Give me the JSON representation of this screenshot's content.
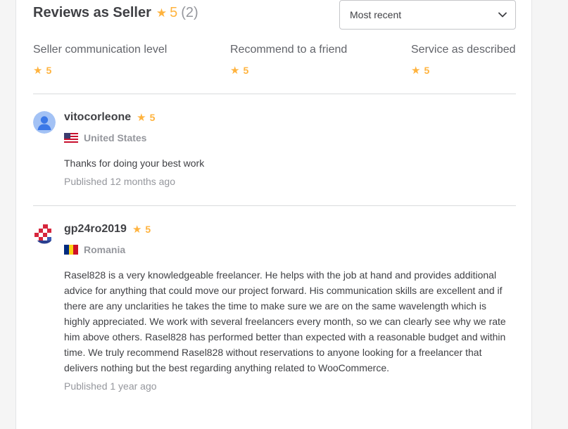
{
  "header": {
    "title": "Reviews as Seller",
    "rating": "5",
    "count": "(2)"
  },
  "sort": {
    "selected": "Most recent"
  },
  "metrics": [
    {
      "label": "Seller communication level",
      "value": "5"
    },
    {
      "label": "Recommend to a friend",
      "value": "5"
    },
    {
      "label": "Service as described",
      "value": "5"
    }
  ],
  "reviews": [
    {
      "username": "vitocorleone",
      "rating": "5",
      "country": "United States",
      "text": "Thanks for doing your best work",
      "published": "Published 12 months ago"
    },
    {
      "username": "gp24ro2019",
      "rating": "5",
      "country": "Romania",
      "text": "Rasel828 is a very knowledgeable freelancer. He helps with the job at hand and provides additional advice for anything that could move our project forward. His communication skills are excellent and if there are any unclarities he takes the time to make sure we are on the same wavelength which is highly appreciated. We work with several freelancers every month, so we can clearly see why we rate him above others. Rasel828 has performed better than expected with a reasonable budget and within time. We truly recommend Rasel828 without reservations to anyone looking for a freelancer that delivers nothing but the best regarding anything related to WooCommerce.",
      "published": "Published 1 year ago"
    }
  ],
  "colors": {
    "star": "#ffb33e",
    "text": "#404145",
    "muted": "#95979d",
    "divider": "#dadbdd"
  },
  "icons": {
    "star": "star-icon",
    "sort_chevron": "chevron-down-icon",
    "avatar_default": "user-avatar-icon",
    "flag_us": "flag-us-icon",
    "flag_ro": "flag-ro-icon"
  }
}
